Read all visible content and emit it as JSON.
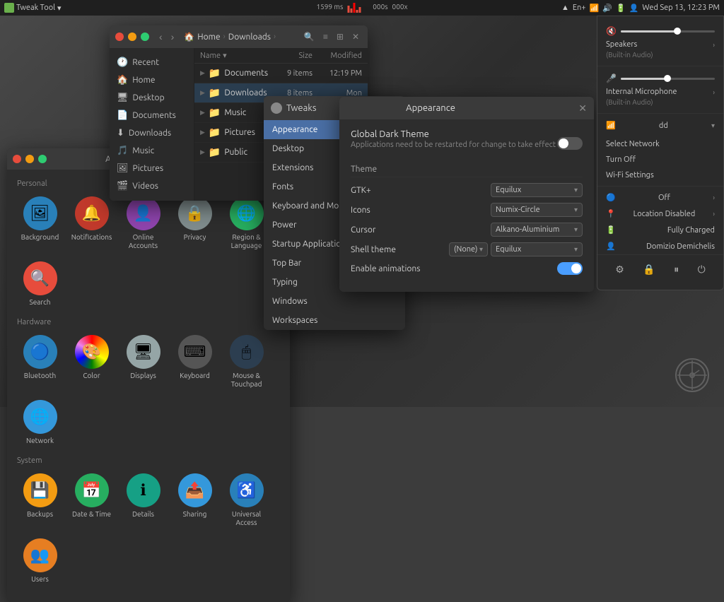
{
  "taskbar": {
    "app_name": "Tweak Tool",
    "clock": "Wed Sep 13, 12:23 PM",
    "keyboard": "En+",
    "stats": "1599 ms",
    "stats2": "000s",
    "stats3": "000x"
  },
  "file_manager": {
    "title": "Home",
    "path_label": "Downloads",
    "sidebar_items": [
      {
        "icon": "🕐",
        "label": "Recent"
      },
      {
        "icon": "🏠",
        "label": "Home"
      },
      {
        "icon": "🖥",
        "label": "Desktop"
      },
      {
        "icon": "📄",
        "label": "Documents"
      },
      {
        "icon": "⬇",
        "label": "Downloads"
      },
      {
        "icon": "🎵",
        "label": "Music"
      },
      {
        "icon": "🖼",
        "label": "Pictures"
      },
      {
        "icon": "🎬",
        "label": "Videos"
      }
    ],
    "columns": {
      "name": "Name",
      "size": "Size",
      "modified": "Modified"
    },
    "rows": [
      {
        "name": "Documents",
        "size": "9 items",
        "modified": "12:19 PM",
        "expanded": false
      },
      {
        "name": "Downloads",
        "size": "8 items",
        "modified": "Mon",
        "expanded": true
      },
      {
        "name": "Music",
        "size": "",
        "modified": "",
        "expanded": false
      },
      {
        "name": "Pictures",
        "size": "",
        "modified": "",
        "expanded": false
      },
      {
        "name": "Public",
        "size": "",
        "modified": "",
        "expanded": false
      }
    ]
  },
  "tweaks": {
    "title": "Tweaks",
    "items": [
      {
        "label": "Appearance",
        "active": true
      },
      {
        "label": "Desktop",
        "active": false
      },
      {
        "label": "Extensions",
        "active": false
      },
      {
        "label": "Fonts",
        "active": false
      },
      {
        "label": "Keyboard and Mouse",
        "active": false
      },
      {
        "label": "Power",
        "active": false
      },
      {
        "label": "Startup Applications",
        "active": false
      },
      {
        "label": "Top Bar",
        "active": false
      },
      {
        "label": "Typing",
        "active": false
      },
      {
        "label": "Windows",
        "active": false
      },
      {
        "label": "Workspaces",
        "active": false
      }
    ]
  },
  "appearance": {
    "title": "Appearance",
    "dark_theme_label": "Global Dark Theme",
    "dark_theme_desc": "Applications need to be restarted for change to take effect",
    "dark_theme_on": false,
    "theme_section": "Theme",
    "gtk_label": "GTK+",
    "gtk_value": "Equilux",
    "icons_label": "Icons",
    "icons_value": "Numix-Circle",
    "cursor_label": "Cursor",
    "cursor_value": "Alkano-Aluminium",
    "shell_label": "Shell theme",
    "shell_prefix": "(None)",
    "shell_value": "Equilux",
    "animations_label": "Enable animations",
    "animations_on": true
  },
  "settings": {
    "title": "All Settings",
    "sections": {
      "personal": {
        "label": "Personal",
        "items": [
          {
            "icon": "🖼",
            "label": "Background",
            "color": "#3498db"
          },
          {
            "icon": "🔔",
            "label": "Notifications",
            "color": "#e74c3c"
          },
          {
            "icon": "👤",
            "label": "Online Accounts",
            "color": "#9b59b6"
          },
          {
            "icon": "🔒",
            "label": "Privacy",
            "color": "#8e44ad"
          },
          {
            "icon": "🌐",
            "label": "Region & Language",
            "color": "#27ae60"
          },
          {
            "icon": "🔍",
            "label": "Search",
            "color": "#e74c3c"
          }
        ]
      },
      "hardware": {
        "label": "Hardware",
        "items": [
          {
            "icon": "🔵",
            "label": "Bluetooth",
            "color": "#3498db"
          },
          {
            "icon": "🎨",
            "label": "Color",
            "color": "#e74c3c"
          },
          {
            "icon": "🖥",
            "label": "Displays",
            "color": "#95a5a6"
          },
          {
            "icon": "⌨",
            "label": "Keyboard",
            "color": "#7f8c8d"
          },
          {
            "icon": "🖱",
            "label": "Mouse & Touchpad",
            "color": "#2c3e50"
          },
          {
            "icon": "🌐",
            "label": "Network",
            "color": "#3498db"
          }
        ]
      },
      "system": {
        "label": "System",
        "items": [
          {
            "icon": "💾",
            "label": "Backups",
            "color": "#f39c12"
          },
          {
            "icon": "📅",
            "label": "Date & Time",
            "color": "#27ae60"
          },
          {
            "icon": "ℹ",
            "label": "Details",
            "color": "#16a085"
          },
          {
            "icon": "📤",
            "label": "Sharing",
            "color": "#3498db"
          },
          {
            "icon": "♿",
            "label": "Universal Access",
            "color": "#2980b9"
          },
          {
            "icon": "👥",
            "label": "Users",
            "color": "#e67e22"
          }
        ]
      }
    }
  },
  "tray_popup": {
    "speaker_label": "Speakers",
    "speaker_sub": "(Built-in Audio)",
    "mic_label": "Internal Microphone",
    "mic_sub": "(Built-in Audio)",
    "network_name": "dd",
    "select_network": "Select Network",
    "turn_off": "Turn Off",
    "wifi_settings": "Wi-Fi Settings",
    "bluetooth_off": "Off",
    "location": "Location Disabled",
    "battery": "Fully Charged",
    "user": "Domizio Demichelis",
    "speaker_vol": 70,
    "mic_vol": 50,
    "output_vol": 60
  },
  "icons": {
    "folder": "📁",
    "home": "🏠",
    "back": "‹",
    "forward": "›",
    "close": "✕",
    "search": "🔍",
    "grid": "⊞",
    "list": "≡",
    "menu": "⋮",
    "chevron_right": "›",
    "chevron_down": "▾",
    "speaker": "🔊",
    "mic": "🎤",
    "wifi": "WiFi",
    "bluetooth": "BT",
    "battery": "🔋",
    "settings": "⚙",
    "dropdown": "▾"
  }
}
